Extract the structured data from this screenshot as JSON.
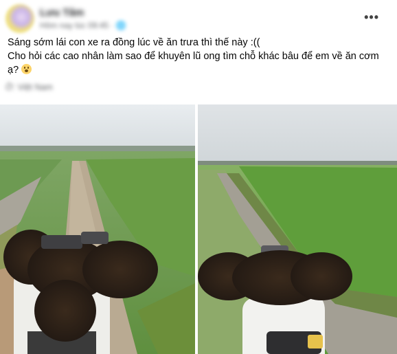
{
  "post": {
    "author_name": "Lưu Tâm",
    "timestamp": "Hôm nay lúc 09:45 · 🌐",
    "more_icon": "more-horizontal-icon",
    "text_line1": "Sáng sớm lái con xe ra đồng lúc về ăn trưa thì thế này :((",
    "text_line2": "Cho hỏi các cao nhân làm sao để khuyên lũ ong tìm chỗ khác bâu để em về ăn cơm",
    "text_line3": "ạ?",
    "emoji": "astonished-face-icon",
    "location": "Ở: Việt Nam"
  },
  "colors": {
    "text": "#050505",
    "secondary": "#65676b",
    "background": "#ffffff"
  }
}
